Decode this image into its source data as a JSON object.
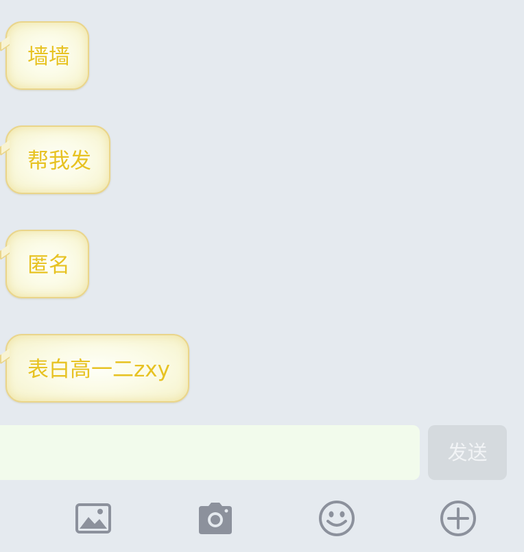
{
  "messages": [
    {
      "text": "墙墙"
    },
    {
      "text": "帮我发"
    },
    {
      "text": "匿名"
    },
    {
      "text": "表白高一二zxy"
    }
  ],
  "composer": {
    "input_value": "",
    "input_placeholder": "",
    "send_label": "发送"
  },
  "toolbar": {
    "items": [
      {
        "icon": "image-icon"
      },
      {
        "icon": "camera-icon"
      },
      {
        "icon": "emoji-icon"
      },
      {
        "icon": "plus-icon"
      }
    ]
  },
  "colors": {
    "background": "#e5eaef",
    "bubble_text": "#e7c222",
    "bubble_border": "#ead58a",
    "input_background": "#f2fbec",
    "send_button_background": "#d5dade",
    "icon": "#8c919c"
  }
}
